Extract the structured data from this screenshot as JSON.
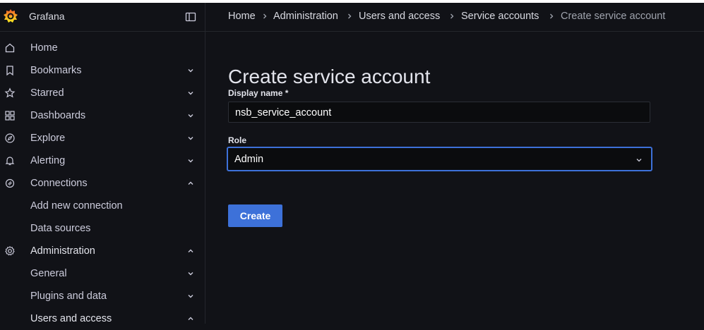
{
  "app": {
    "name": "Grafana"
  },
  "sidebar": {
    "items": [
      {
        "label": "Home",
        "icon": "home-icon",
        "expanded": null
      },
      {
        "label": "Bookmarks",
        "icon": "bookmark-icon",
        "expanded": false
      },
      {
        "label": "Starred",
        "icon": "star-icon",
        "expanded": false
      },
      {
        "label": "Dashboards",
        "icon": "apps-icon",
        "expanded": false
      },
      {
        "label": "Explore",
        "icon": "compass-icon",
        "expanded": false
      },
      {
        "label": "Alerting",
        "icon": "bell-icon",
        "expanded": false
      },
      {
        "label": "Connections",
        "icon": "plug-icon",
        "expanded": true
      },
      {
        "label": "Add new connection",
        "icon": null,
        "expanded": null
      },
      {
        "label": "Data sources",
        "icon": null,
        "expanded": null
      },
      {
        "label": "Administration",
        "icon": "cog-icon",
        "expanded": true
      },
      {
        "label": "General",
        "icon": null,
        "expanded": false
      },
      {
        "label": "Plugins and data",
        "icon": null,
        "expanded": false
      },
      {
        "label": "Users and access",
        "icon": null,
        "expanded": true
      }
    ]
  },
  "breadcrumb": [
    "Home",
    "Administration",
    "Users and access",
    "Service accounts",
    "Create service account"
  ],
  "form": {
    "title": "Create service account",
    "display_name_label": "Display name *",
    "display_name_value": "nsb_service_account",
    "role_label": "Role",
    "role_value": "Admin",
    "submit_label": "Create"
  },
  "colors": {
    "accent": "#3d71d9",
    "background": "#111217",
    "input_bg": "#0b0c0e"
  }
}
